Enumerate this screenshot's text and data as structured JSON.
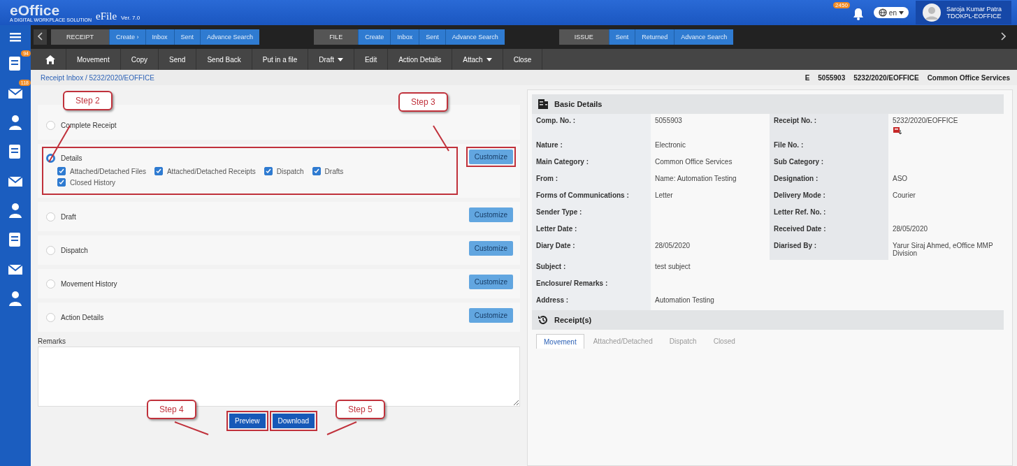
{
  "header": {
    "logo": "eOffice",
    "tagline": "A DIGITAL WORKPLACE SOLUTION",
    "app": "eFile",
    "version": "Ver. 7.0",
    "notifications": "2450",
    "language": "en",
    "user_name": "Saroja Kumar Patra",
    "user_unit": "TDOKPL-EOFFICE"
  },
  "sidebar_badges": [
    "94",
    "118"
  ],
  "nav": [
    {
      "group": "RECEIPT",
      "links": [
        "Create ›",
        "Inbox",
        "Sent",
        "Advance Search"
      ]
    },
    {
      "group": "FILE",
      "links": [
        "Create",
        "Inbox",
        "Sent",
        "Advance Search"
      ]
    },
    {
      "group": "ISSUE",
      "links": [
        "Sent",
        "Returned",
        "Advance Search"
      ]
    }
  ],
  "toolbar": [
    {
      "label": "Movement",
      "dropdown": false
    },
    {
      "label": "Copy",
      "dropdown": false
    },
    {
      "label": "Send",
      "dropdown": false
    },
    {
      "label": "Send Back",
      "dropdown": false
    },
    {
      "label": "Put in a file",
      "dropdown": false
    },
    {
      "label": "Draft",
      "dropdown": true
    },
    {
      "label": "Edit",
      "dropdown": false
    },
    {
      "label": "Action Details",
      "dropdown": false
    },
    {
      "label": "Attach",
      "dropdown": true
    },
    {
      "label": "Close",
      "dropdown": false
    }
  ],
  "breadcrumb": "Receipt Inbox / 5232/2020/EOFFICE",
  "receipt_info": [
    "E",
    "5055903",
    "5232/2020/EOFFICE",
    "Common Office Services"
  ],
  "options": [
    {
      "label": "Complete Receipt",
      "selected": false,
      "highlighted": false
    },
    {
      "label": "Details",
      "selected": true,
      "customize": "Customize",
      "highlighted": true,
      "customize_highlighted": true,
      "checkboxes": [
        {
          "label": "Attached/Detached Files",
          "checked": true
        },
        {
          "label": "Attached/Detached Receipts",
          "checked": true
        },
        {
          "label": "Dispatch",
          "checked": true
        },
        {
          "label": "Drafts",
          "checked": true
        },
        {
          "label": "Closed History",
          "checked": true
        }
      ]
    },
    {
      "label": "Draft",
      "selected": false,
      "customize": "Customize",
      "highlighted": false,
      "customize_highlighted": false
    },
    {
      "label": "Dispatch",
      "selected": false,
      "customize": "Customize",
      "highlighted": false,
      "customize_highlighted": false
    },
    {
      "label": "Movement History",
      "selected": false,
      "customize": "Customize",
      "highlighted": false,
      "customize_highlighted": false
    },
    {
      "label": "Action Details",
      "selected": false,
      "customize": "Customize",
      "highlighted": false,
      "customize_highlighted": false
    }
  ],
  "remarks_label": "Remarks",
  "actions": [
    {
      "label": "Preview",
      "highlighted": true
    },
    {
      "label": "Download",
      "highlighted": true
    }
  ],
  "callouts": [
    "Step 2",
    "Step 3",
    "Step 4",
    "Step 5"
  ],
  "basic_details": {
    "title": "Basic Details",
    "rows": [
      [
        {
          "label": "Comp. No. :",
          "value": "5055903"
        },
        {
          "label": "Receipt No. :",
          "value": "5232/2020/EOFFICE",
          "attachment": true
        }
      ],
      [
        {
          "label": "Nature :",
          "value": "Electronic"
        },
        {
          "label": "File No. :"
        }
      ],
      [
        {
          "label": "Main Category :",
          "value": "Common Office Services"
        },
        {
          "label": "Sub Category :"
        }
      ],
      [
        {
          "label": "From :",
          "value": "Name: Automation Testing"
        },
        {
          "label": "Designation :",
          "value": "ASO"
        }
      ],
      [
        {
          "label": "Forms of Communications :",
          "value": "Letter"
        },
        {
          "label": "Delivery Mode :",
          "value": "Courier"
        }
      ],
      [
        {
          "label": "Sender Type :"
        },
        {
          "label": "Letter Ref. No. :"
        }
      ],
      [
        {
          "label": "Letter Date :"
        },
        {
          "label": "Received Date :",
          "value": "28/05/2020"
        }
      ],
      [
        {
          "label": "Diary Date :",
          "value": "28/05/2020"
        },
        {
          "label": "Diarised By :",
          "value": "Yarur Siraj Ahmed, eOffice MMP Division"
        }
      ],
      [
        {
          "label": "Subject :",
          "value": "test subject"
        }
      ],
      [
        {
          "label": "Enclosure/ Remarks :"
        }
      ],
      [
        {
          "label": "Address :",
          "value": "Automation Testing"
        }
      ]
    ]
  },
  "receipts": {
    "title": "Receipt(s)",
    "tabs": [
      {
        "label": "Movement",
        "selected": true
      },
      {
        "label": "Attached/Detached",
        "selected": false
      },
      {
        "label": "Dispatch",
        "selected": false
      },
      {
        "label": "Closed",
        "selected": false
      }
    ]
  }
}
